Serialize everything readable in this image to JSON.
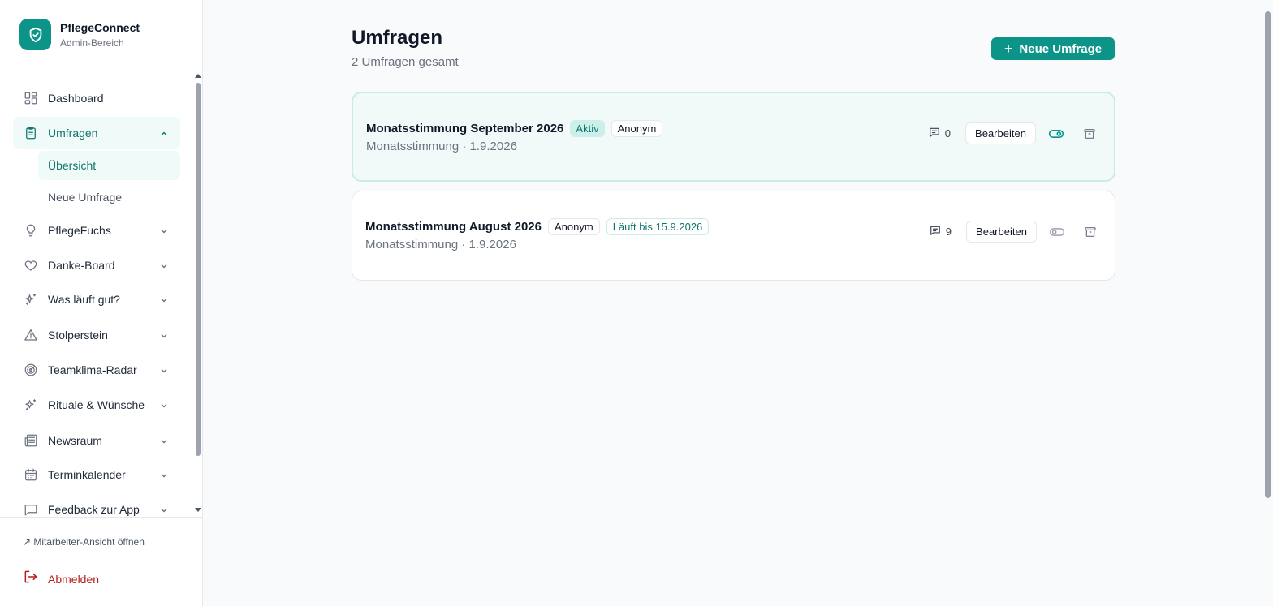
{
  "brand": {
    "name": "PflegeConnect",
    "subtitle": "Admin-Bereich"
  },
  "nav": {
    "items": [
      {
        "label": "Dashboard"
      },
      {
        "label": "Umfragen",
        "sub": [
          {
            "label": "Übersicht"
          },
          {
            "label": "Neue Umfrage"
          }
        ]
      },
      {
        "label": "PflegeFuchs"
      },
      {
        "label": "Danke-Board"
      },
      {
        "label": "Was läuft gut?"
      },
      {
        "label": "Stolperstein"
      },
      {
        "label": "Teamklima-Radar"
      },
      {
        "label": "Rituale & Wünsche"
      },
      {
        "label": "Newsraum"
      },
      {
        "label": "Terminkalender"
      },
      {
        "label": "Feedback zur App"
      }
    ]
  },
  "footer": {
    "staff_link": "↗ Mitarbeiter-Ansicht öffnen",
    "logout": "Abmelden"
  },
  "main": {
    "title": "Umfragen",
    "subtitle": "2 Umfragen gesamt",
    "new_button": "Neue Umfrage",
    "new_button_plus": "+",
    "surveys": [
      {
        "title": "Monatsstimmung September 2026",
        "badges": [
          "Aktiv",
          "Anonym"
        ],
        "meta": "Monatsstimmung · 1.9.2026",
        "responses": "0",
        "edit": "Bearbeiten"
      },
      {
        "title": "Monatsstimmung August 2026",
        "badges": [
          "Anonym",
          "Läuft bis 15.9.2026"
        ],
        "meta": "Monatsstimmung · 1.9.2026",
        "responses": "9",
        "edit": "Bearbeiten"
      }
    ]
  },
  "colors": {
    "accent": "#0d9488",
    "accent_dark": "#0f766e",
    "danger": "#b91c1c"
  }
}
